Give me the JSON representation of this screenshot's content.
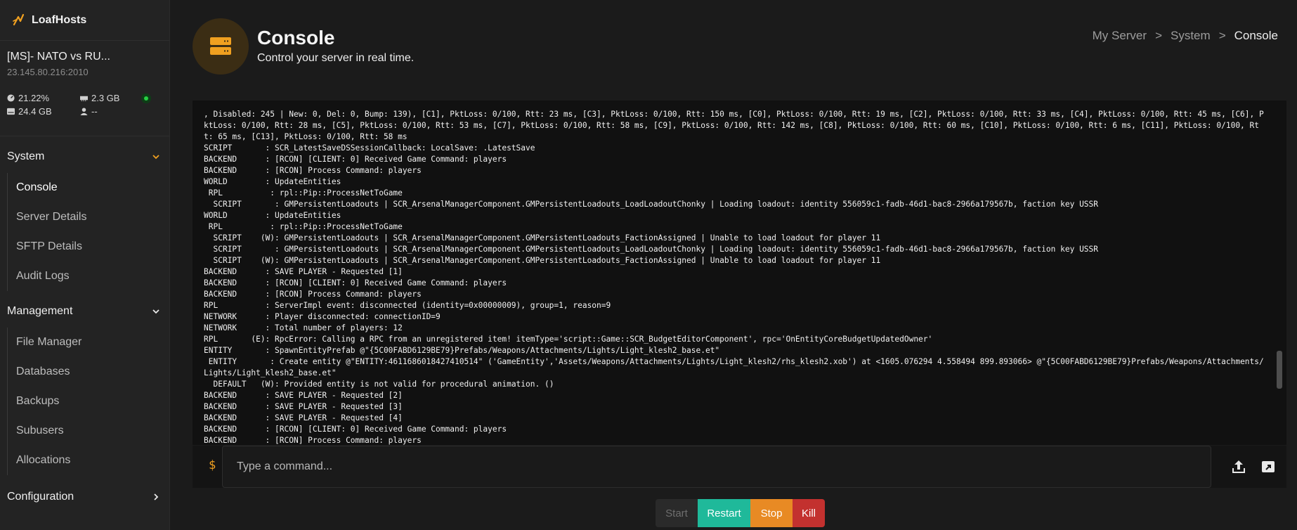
{
  "brand": {
    "name": "LoafHosts"
  },
  "server": {
    "name": "[MS]- NATO vs RU...",
    "address": "23.145.80.216:2010",
    "status_color": "#26d042",
    "stats": {
      "cpu": "21.22%",
      "memory": "2.3 GB",
      "disk": "24.4 GB",
      "players": "--"
    }
  },
  "sidebar": {
    "sections": [
      {
        "label": "System",
        "expanded": true,
        "items": [
          "Console",
          "Server Details",
          "SFTP Details",
          "Audit Logs"
        ]
      },
      {
        "label": "Management",
        "expanded": true,
        "items": [
          "File Manager",
          "Databases",
          "Backups",
          "Subusers",
          "Allocations"
        ]
      },
      {
        "label": "Configuration",
        "expanded": false,
        "items": []
      }
    ],
    "active_item": "Console"
  },
  "header": {
    "title": "Console",
    "subtitle": "Control your server in real time.",
    "breadcrumb": [
      "My Server",
      ">",
      "System",
      ">",
      "Console"
    ]
  },
  "console": {
    "lines": [
      ", Disabled: 245 | New: 0, Del: 0, Bump: 139), [C1], PktLoss: 0/100, Rtt: 23 ms, [C3], PktLoss: 0/100, Rtt: 150 ms, [C0], PktLoss: 0/100, Rtt: 19 ms, [C2], PktLoss: 0/100, Rtt: 33 ms, [C4], PktLoss: 0/100, Rtt: 45 ms, [C6], PktLoss: 0/100, Rtt: 28 ms, [C5], PktLoss: 0/100, Rtt: 53 ms, [C7], PktLoss: 0/100, Rtt: 58 ms, [C9], PktLoss: 0/100, Rtt: 142 ms, [C8], PktLoss: 0/100, Rtt: 60 ms, [C10], PktLoss: 0/100, Rtt: 6 ms, [C11], PktLoss: 0/100, Rtt: 65 ms, [C13], PktLoss: 0/100, Rtt: 58 ms",
      "SCRIPT       : SCR_LatestSaveDSSessionCallback: LocalSave: .LatestSave",
      "BACKEND      : [RCON] [CLIENT: 0] Received Game Command: players",
      "BACKEND      : [RCON] Process Command: players",
      "WORLD        : UpdateEntities",
      " RPL          : rpl::Pip::ProcessNetToGame",
      "  SCRIPT       : GMPersistentLoadouts | SCR_ArsenalManagerComponent.GMPersistentLoadouts_LoadLoadoutChonky | Loading loadout: identity 556059c1-fadb-46d1-bac8-2966a179567b, faction key USSR",
      "WORLD        : UpdateEntities",
      " RPL          : rpl::Pip::ProcessNetToGame",
      "  SCRIPT    (W): GMPersistentLoadouts | SCR_ArsenalManagerComponent.GMPersistentLoadouts_FactionAssigned | Unable to load loadout for player 11",
      "  SCRIPT       : GMPersistentLoadouts | SCR_ArsenalManagerComponent.GMPersistentLoadouts_LoadLoadoutChonky | Loading loadout: identity 556059c1-fadb-46d1-bac8-2966a179567b, faction key USSR",
      "  SCRIPT    (W): GMPersistentLoadouts | SCR_ArsenalManagerComponent.GMPersistentLoadouts_FactionAssigned | Unable to load loadout for player 11",
      "BACKEND      : SAVE PLAYER - Requested [1]",
      "BACKEND      : [RCON] [CLIENT: 0] Received Game Command: players",
      "BACKEND      : [RCON] Process Command: players",
      "RPL          : ServerImpl event: disconnected (identity=0x00000009), group=1, reason=9",
      "NETWORK      : Player disconnected: connectionID=9",
      "NETWORK      : Total number of players: 12",
      "RPL       (E): RpcError: Calling a RPC from an unregistered item! itemType='script::Game::SCR_BudgetEditorComponent', rpc='OnEntityCoreBudgetUpdatedOwner'",
      "ENTITY       : SpawnEntityPrefab @\"{5C00FABD6129BE79}Prefabs/Weapons/Attachments/Lights/Light_klesh2_base.et\"",
      " ENTITY       : Create entity @\"ENTITY:4611686018427410514\" ('GameEntity','Assets/Weapons/Attachments/Lights/Light_klesh2/rhs_klesh2.xob') at <1605.076294 4.558494 899.893066> @\"{5C00FABD6129BE79}Prefabs/Weapons/Attachments/Lights/Light_klesh2_base.et\"",
      "  DEFAULT   (W): Provided entity is not valid for procedural animation. ()",
      "BACKEND      : SAVE PLAYER - Requested [2]",
      "BACKEND      : SAVE PLAYER - Requested [3]",
      "BACKEND      : SAVE PLAYER - Requested [4]",
      "BACKEND      : [RCON] [CLIENT: 0] Received Game Command: players",
      "BACKEND      : [RCON] Process Command: players"
    ]
  },
  "command": {
    "prompt": "$",
    "placeholder": "Type a command..."
  },
  "power": {
    "start": "Start",
    "restart": "Restart",
    "stop": "Stop",
    "kill": "Kill"
  },
  "colors": {
    "accent": "#f0a020",
    "restart": "#1fb99a",
    "stop": "#e88a24",
    "kill": "#c3312f"
  }
}
